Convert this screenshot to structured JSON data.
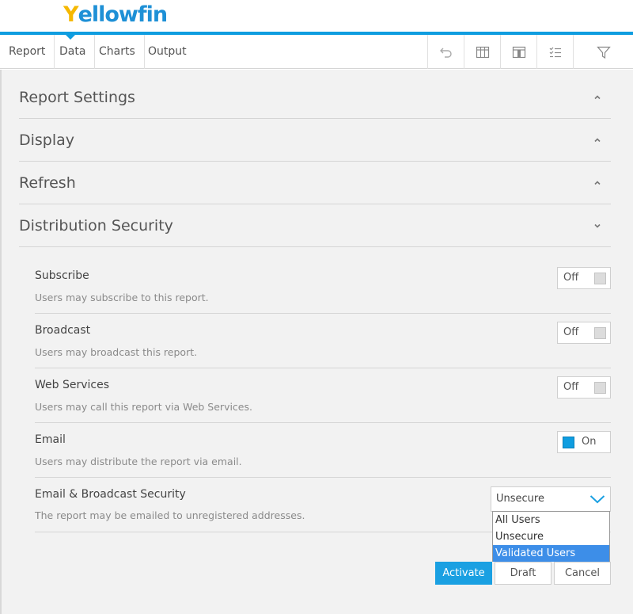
{
  "logo": {
    "first": "Y",
    "rest": "ellowfin"
  },
  "tabs": [
    {
      "label": "Report"
    },
    {
      "label": "Data"
    },
    {
      "label": "Charts"
    },
    {
      "label": "Output"
    }
  ],
  "toolbar": [
    {
      "icon": "undo-icon"
    },
    {
      "icon": "table-columns-icon"
    },
    {
      "icon": "column-insert-icon"
    },
    {
      "icon": "checklist-icon"
    },
    {
      "icon": "filter-icon"
    }
  ],
  "sections": [
    {
      "title": "Report Settings",
      "expanded": false
    },
    {
      "title": "Display",
      "expanded": false
    },
    {
      "title": "Refresh",
      "expanded": false
    },
    {
      "title": "Distribution Security",
      "expanded": true
    }
  ],
  "settings": [
    {
      "label": "Subscribe",
      "description": "Users may subscribe to this report.",
      "state": "Off"
    },
    {
      "label": "Broadcast",
      "description": "Users may broadcast this report.",
      "state": "Off"
    },
    {
      "label": "Web Services",
      "description": "Users may call this report via Web Services.",
      "state": "Off"
    },
    {
      "label": "Email",
      "description": "Users may distribute the report via email.",
      "state": "On"
    }
  ],
  "email_security": {
    "label": "Email & Broadcast Security",
    "description": "The report may be emailed to unregistered addresses.",
    "selected": "Unsecure",
    "options": [
      "All Users",
      "Unsecure",
      "Validated Users"
    ],
    "highlighted": "Validated Users"
  },
  "buttons": {
    "activate": "Activate",
    "draft": "Draft",
    "cancel": "Cancel"
  },
  "colors": {
    "accent": "#0f9de0",
    "logo_yellow": "#f5b800",
    "logo_blue": "#1e90d6",
    "highlight": "#3d8ee8"
  }
}
